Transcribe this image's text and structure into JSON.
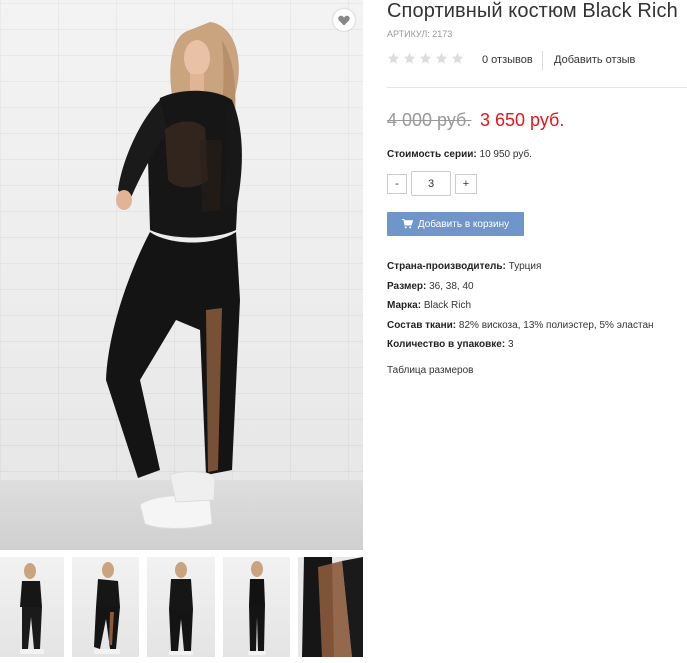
{
  "product": {
    "title": "Спортивный костюм Black Rich",
    "sku": "АРТИКУЛ: 2173",
    "rating": 0,
    "rating_max": 5,
    "reviews_count_label": "0 отзывов",
    "add_review_label": "Добавить отзыв",
    "old_price": "4 000 руб.",
    "new_price": "3 650 руб.",
    "series_cost_label": "Стоимость серии:",
    "series_cost_value": "10 950 руб."
  },
  "quantity": {
    "minus_label": "-",
    "value": "3",
    "plus_label": "+"
  },
  "cart": {
    "button_label": "Добавить в корзину"
  },
  "properties": [
    {
      "label": "Страна-производитель:",
      "value": "Турция"
    },
    {
      "label": "Размер:",
      "value": "36, 38, 40"
    },
    {
      "label": "Марка:",
      "value": "Black Rich"
    },
    {
      "label": "Состав ткани:",
      "value": "82% вискоза, 13% полиэстер, 5% эластан"
    },
    {
      "label": "Количество в упаковке:",
      "value": "3"
    }
  ],
  "size_table_link": "Таблица размеров",
  "icons": {
    "favorite": "heart-icon",
    "cart": "cart-icon",
    "rating": "star-icon"
  },
  "colors": {
    "price_new": "#e8141b",
    "price_old": "#999999",
    "cart_button": "#6f95c9",
    "star_empty": "#dddddd"
  },
  "gallery": {
    "thumbnail_count": 5
  }
}
